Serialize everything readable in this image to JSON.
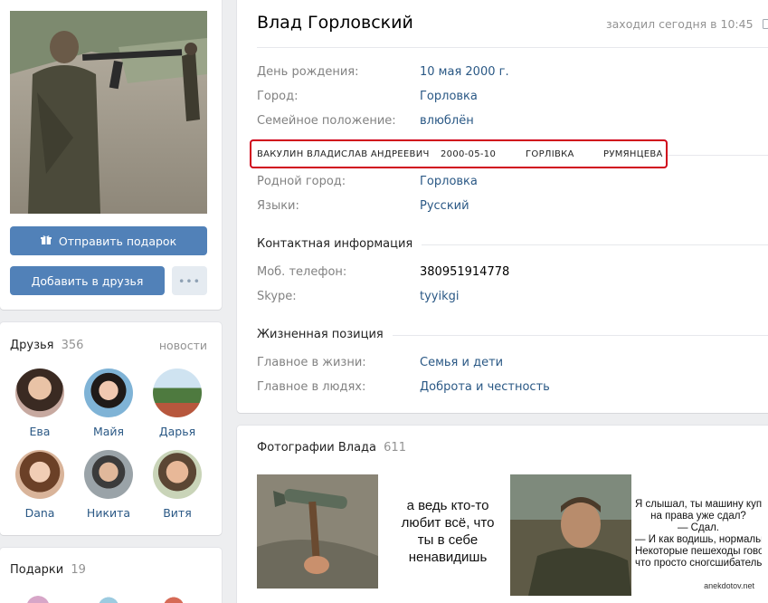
{
  "profile": {
    "name": "Влад Горловский",
    "last_seen": "заходил сегодня в 10:45"
  },
  "actions": {
    "send_gift": "Отправить подарок",
    "add_friend": "Добавить в друзья",
    "more": "•••"
  },
  "info": {
    "birthday_label": "День рождения:",
    "birthday_value": "10 мая 2000 г.",
    "city_label": "Город:",
    "city_value": "Горловка",
    "relationship_label": "Семейное положение:",
    "relationship_value": "влюблён",
    "hometown_label": "Родной город:",
    "hometown_value": "Горловка",
    "languages_label": "Языки:",
    "languages_value": "Русский"
  },
  "highlight": {
    "full_name": "ВАКУЛИН ВЛАДИСЛАВ АНДРЕЕВИЧ",
    "date": "2000-05-10",
    "city": "ГОРЛІВКА",
    "street": "РУМЯНЦЕВА",
    "border_color": "#d0021b"
  },
  "contacts": {
    "title": "Контактная информация",
    "phone_label": "Моб. телефон:",
    "phone_value": "380951914778",
    "skype_label": "Skype:",
    "skype_value": "tyyikgi"
  },
  "position": {
    "title": "Жизненная позиция",
    "main_life_label": "Главное в жизни:",
    "main_life_value": "Семья и дети",
    "main_people_label": "Главное в людях:",
    "main_people_value": "Доброта и честность"
  },
  "friends": {
    "title": "Друзья",
    "count": "356",
    "news_link": "новости",
    "items": [
      {
        "name": "Ева"
      },
      {
        "name": "Майя"
      },
      {
        "name": "Дарья"
      },
      {
        "name": "Dana"
      },
      {
        "name": "Никита"
      },
      {
        "name": "Витя"
      }
    ]
  },
  "gifts": {
    "title": "Подарки",
    "count": "19"
  },
  "photos": {
    "title": "Фотографии Влада",
    "count": "611",
    "meme_text": "а ведь кто-то любит всё, что ты в себе ненавидишь",
    "joke_lines": [
      "Я слышал, ты машину купил",
      "на права уже сдал?",
      "— Сдал.",
      "— И как водишь, нормально?",
      "Некоторые пешеходы говорят,",
      "что просто сногсшибательно"
    ],
    "joke_site": "anekdotov.net"
  },
  "colors": {
    "accent": "#5181b8",
    "link": "#2a5885",
    "background": "#edeef0"
  }
}
